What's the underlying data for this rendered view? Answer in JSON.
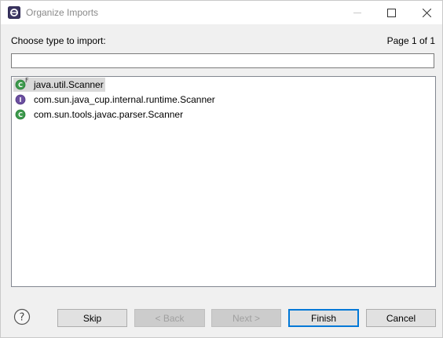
{
  "window": {
    "title": "Organize Imports",
    "icon": "eclipse-icon"
  },
  "prompt": {
    "label": "Choose type to import:",
    "page": "Page 1 of 1"
  },
  "filter": {
    "value": "",
    "placeholder": ""
  },
  "types": [
    {
      "name": "java.util.Scanner",
      "icon": "class-icon",
      "overlay": "F",
      "selected": true
    },
    {
      "name": "com.sun.java_cup.internal.runtime.Scanner",
      "icon": "interface-icon",
      "overlay": "",
      "selected": false
    },
    {
      "name": "com.sun.tools.javac.parser.Scanner",
      "icon": "class-icon",
      "overlay": "",
      "selected": false
    }
  ],
  "buttons": {
    "help": "?",
    "skip": "Skip",
    "back": "< Back",
    "next": "Next >",
    "finish": "Finish",
    "cancel": "Cancel"
  },
  "colors": {
    "class_icon": "#3c9a4c",
    "interface_icon": "#6b4fa0",
    "selection": "#d9d9d9",
    "default_button_border": "#0078d7"
  }
}
